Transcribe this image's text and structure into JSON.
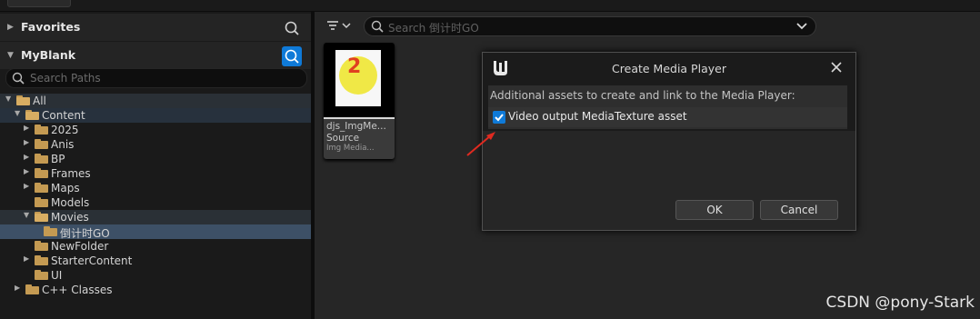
{
  "left_panel": {
    "favorites_title": "Favorites",
    "project_title": "MyBlank",
    "search_paths_placeholder": "Search Paths",
    "tree": [
      {
        "label": "All"
      },
      {
        "label": "Content"
      },
      {
        "label": "2025"
      },
      {
        "label": "Anis"
      },
      {
        "label": "BP"
      },
      {
        "label": "Frames"
      },
      {
        "label": "Maps"
      },
      {
        "label": "Models"
      },
      {
        "label": "Movies"
      },
      {
        "label": "倒计时GO"
      },
      {
        "label": "NewFolder"
      },
      {
        "label": "StarterContent"
      },
      {
        "label": "UI"
      },
      {
        "label": "C++ Classes"
      }
    ]
  },
  "asset_browser": {
    "search_placeholder": "Search 倒计时GO",
    "asset": {
      "name": "djs_ImgMe...",
      "kind": "Source",
      "type": "Img Media...",
      "thumbnail_text": "2"
    }
  },
  "dialog": {
    "title": "Create Media Player",
    "info": "Additional assets to create and link to the Media Player:",
    "checkbox_label": "Video output MediaTexture asset",
    "checkbox_checked": true,
    "ok_label": "OK",
    "cancel_label": "Cancel"
  },
  "watermark": "CSDN @pony-Stark",
  "colors": {
    "accent": "#0f7ad8",
    "selected_row": "#3d5066",
    "folder": "#c49a52",
    "annotation_arrow": "#e02a20"
  }
}
